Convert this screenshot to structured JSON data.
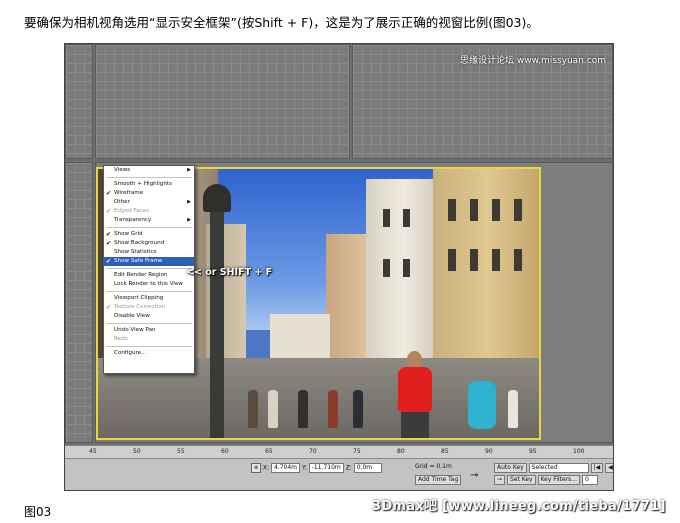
{
  "intro_text": "要确保为相机视角选用“显示安全框架”(按Shift + F)，这是为了展示正确的视窗比例(图03)。",
  "figure_caption": "图03",
  "watermark_top": "思缘设计论坛 www.missyuan.com",
  "watermark_bottom": "3Dmax吧 [www.lineeg.com/tieba/1771]",
  "callout": "<< or  SHIFT + F",
  "menu": {
    "items": [
      {
        "label": "Views",
        "submenu": true,
        "checked": false,
        "disabled": false
      },
      {
        "separator": true
      },
      {
        "label": "Smooth + Highlights",
        "submenu": false,
        "checked": false,
        "disabled": false
      },
      {
        "label": "Wireframe",
        "submenu": false,
        "checked": true,
        "disabled": false
      },
      {
        "label": "Other",
        "submenu": true,
        "checked": false,
        "disabled": false
      },
      {
        "label": "Edged Faces",
        "submenu": false,
        "checked": true,
        "disabled": true
      },
      {
        "label": "Transparency",
        "submenu": true,
        "checked": false,
        "disabled": false
      },
      {
        "separator": true
      },
      {
        "label": "Show Grid",
        "submenu": false,
        "checked": true,
        "disabled": false
      },
      {
        "label": "Show Background",
        "submenu": false,
        "checked": true,
        "disabled": false
      },
      {
        "label": "Show Statistics",
        "submenu": false,
        "checked": false,
        "disabled": false
      },
      {
        "label": "Show Safe Frame",
        "submenu": false,
        "checked": true,
        "disabled": false,
        "highlighted": true
      },
      {
        "separator": true
      },
      {
        "label": "Edit Render Region",
        "submenu": false,
        "checked": false,
        "disabled": false
      },
      {
        "label": "Lock Render to this View",
        "submenu": false,
        "checked": false,
        "disabled": false
      },
      {
        "separator": true
      },
      {
        "label": "Viewport Clipping",
        "submenu": false,
        "checked": false,
        "disabled": false
      },
      {
        "label": "Texture Correction",
        "submenu": false,
        "checked": true,
        "disabled": true
      },
      {
        "label": "Disable View",
        "submenu": false,
        "checked": false,
        "disabled": false
      },
      {
        "separator": true
      },
      {
        "label": "Undo View Pan",
        "submenu": false,
        "checked": false,
        "disabled": false
      },
      {
        "label": "Redo",
        "submenu": false,
        "checked": false,
        "disabled": true
      },
      {
        "separator": true
      },
      {
        "label": "Configure...",
        "submenu": false,
        "checked": false,
        "disabled": false
      }
    ]
  },
  "ruler": {
    "ticks": [
      "45",
      "50",
      "55",
      "60",
      "65",
      "70",
      "75",
      "80",
      "85",
      "90",
      "95",
      "100"
    ]
  },
  "statusbar": {
    "x_label": "X:",
    "x_value": "4.704m",
    "y_label": "Y:",
    "y_value": "-11.710m",
    "z_label": "Z:",
    "z_value": "0.0m",
    "grid_label": "Grid = 0.1m",
    "add_time_tag": "Add Time Tag",
    "auto_key": "Auto Key",
    "selected": "Selected",
    "set_key": "Set Key",
    "key_filters": "Key Filters...",
    "frame_value": "0"
  }
}
